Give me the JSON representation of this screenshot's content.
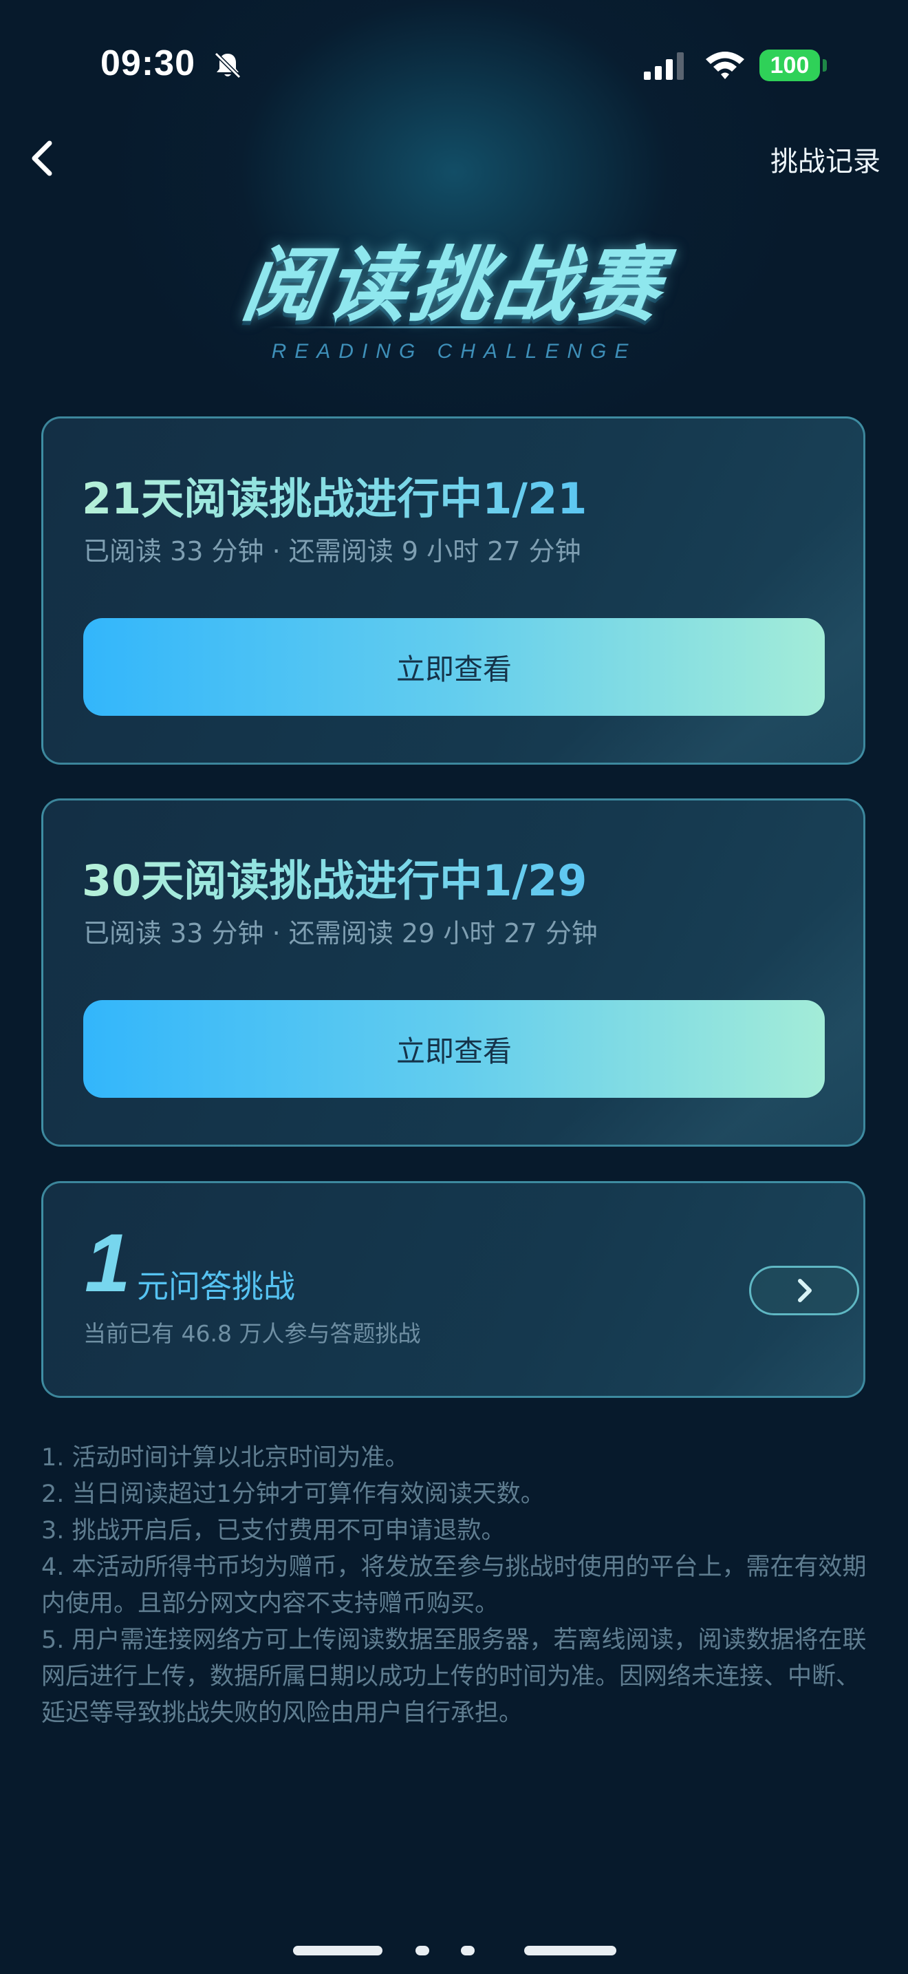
{
  "status_bar": {
    "time": "09:30",
    "battery": "100",
    "icons": [
      "bell-slash-icon",
      "signal-icon",
      "wifi-icon",
      "battery-icon"
    ]
  },
  "nav": {
    "back_icon": "chevron-left-icon",
    "records_label": "挑战记录"
  },
  "hero": {
    "title": "阅读挑战赛",
    "subtitle": "READING CHALLENGE"
  },
  "challenges": [
    {
      "title": "21天阅读挑战进行中1/21",
      "progress": "已阅读 33 分钟 · 还需阅读 9 小时 27 分钟",
      "button_label": "立即查看"
    },
    {
      "title": "30天阅读挑战进行中1/29",
      "progress": "已阅读 33 分钟 · 还需阅读 29 小时 27 分钟",
      "button_label": "立即查看"
    }
  ],
  "quiz": {
    "number": "1",
    "title": "元问答挑战",
    "description": "当前已有 46.8 万人参与答题挑战",
    "arrow_icon": "chevron-right-icon"
  },
  "rules": [
    "1. 活动时间计算以北京时间为准。",
    "2. 当日阅读超过1分钟才可算作有效阅读天数。",
    "3. 挑战开启后，已支付费用不可申请退款。",
    "4. 本活动所得书币均为赠币，将发放至参与挑战时使用的平台上，需在有效期内使用。且部分网文内容不支持赠币购买。",
    "5. 用户需连接网络方可上传阅读数据至服务器，若离线阅读，阅读数据将在联网后进行上传，数据所属日期以成功上传的时间为准。因网络未连接、中断、延迟等导致挑战失败的风险由用户自行承担。"
  ],
  "colors": {
    "background": "#071a2c",
    "accent_gradient_start": "#33b6fb",
    "accent_gradient_end": "#a3ecd8",
    "card_border": "#5fcde1",
    "battery_green": "#2fd158"
  }
}
